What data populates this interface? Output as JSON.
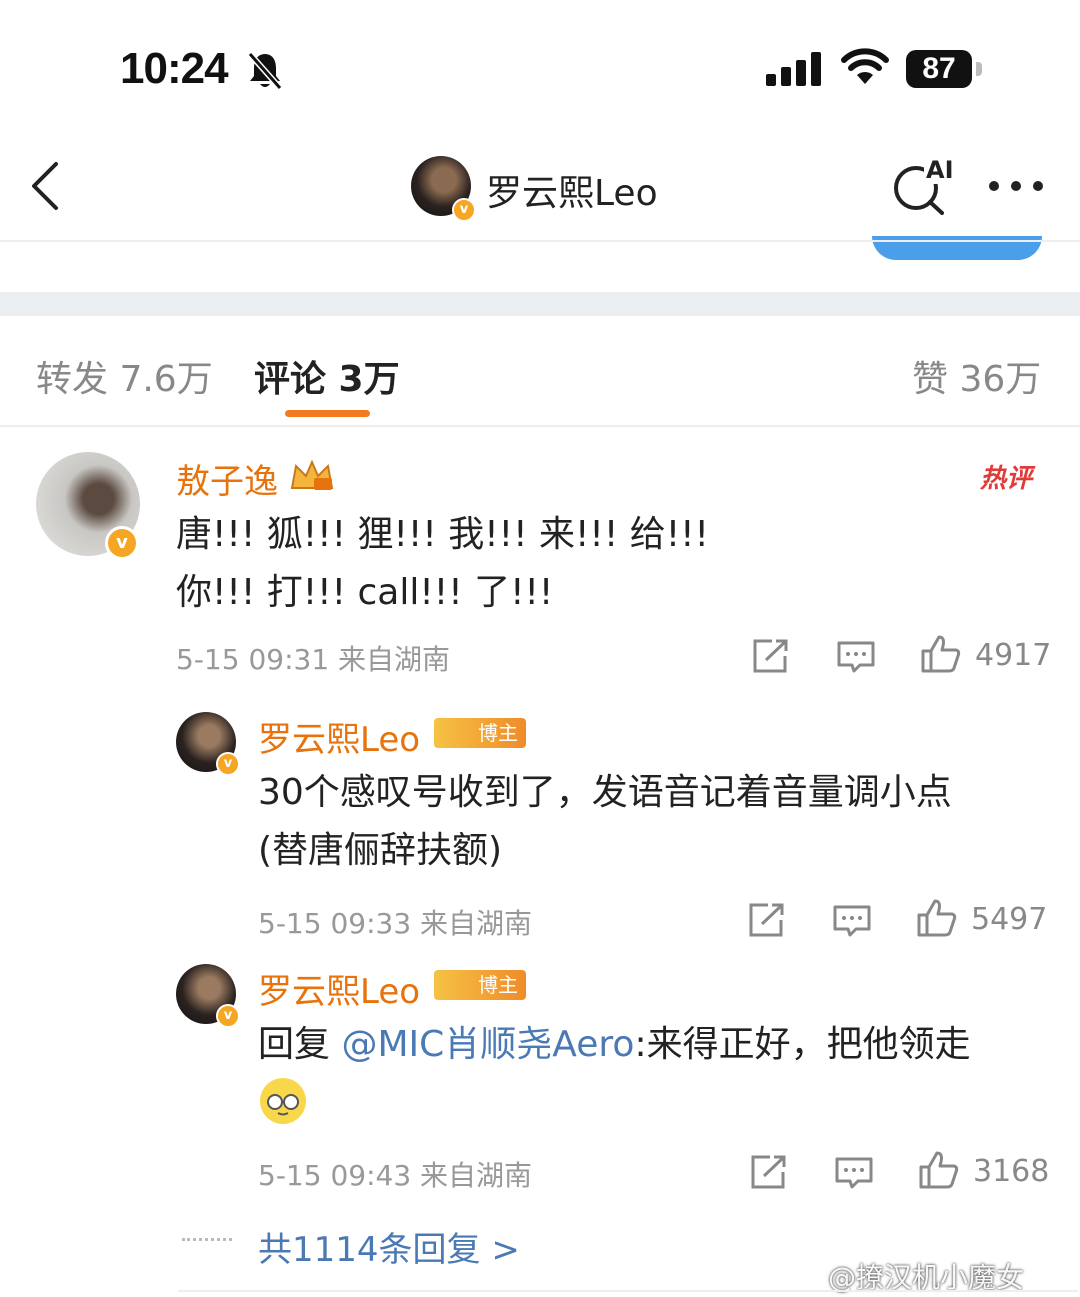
{
  "status_bar": {
    "time": "10:24",
    "battery": "87"
  },
  "nav": {
    "title": "罗云熙Leo",
    "ai_label": "AI",
    "avatar_badge": "v"
  },
  "tabs": [
    {
      "label": "转发 7.6万"
    },
    {
      "label": "评论 3万"
    },
    {
      "label": "赞 36万"
    }
  ],
  "comment": {
    "username": "敖子逸",
    "hot_label": "热评",
    "badge": "v",
    "lines": [
      "唐!!! 狐!!! 狸!!! 我!!! 来!!! 给!!!",
      "你!!! 打!!! call!!! 了!!!"
    ],
    "meta": "5-15 09:31 来自湖南",
    "likes": "4917"
  },
  "replies": [
    {
      "username": "罗云熙Leo",
      "tag": "博主",
      "badge": "v",
      "lines": [
        "30个感叹号收到了，发语音记着音量调小点",
        "(替唐俪辞扶额)"
      ],
      "meta": "5-15 09:33 来自湖南",
      "likes": "5497"
    },
    {
      "username": "罗云熙Leo",
      "tag": "博主",
      "badge": "v",
      "prefix": "回复 ",
      "mention": "@MIC肖顺尧Aero",
      "text": ":来得正好，把他领走",
      "meta": "5-15 09:43 来自湖南",
      "likes": "3168"
    }
  ],
  "more_replies": "共1114条回复 >",
  "watermark": "@撩汉机小魔女",
  "icons": {
    "share": "share-icon",
    "comment": "comment-icon",
    "like": "thumbs-up-icon",
    "back": "chevron-left-icon",
    "more": "more-icon"
  },
  "colors": {
    "accent": "#e8720c",
    "link": "#4a79b4",
    "hot": "#e03b3b"
  }
}
